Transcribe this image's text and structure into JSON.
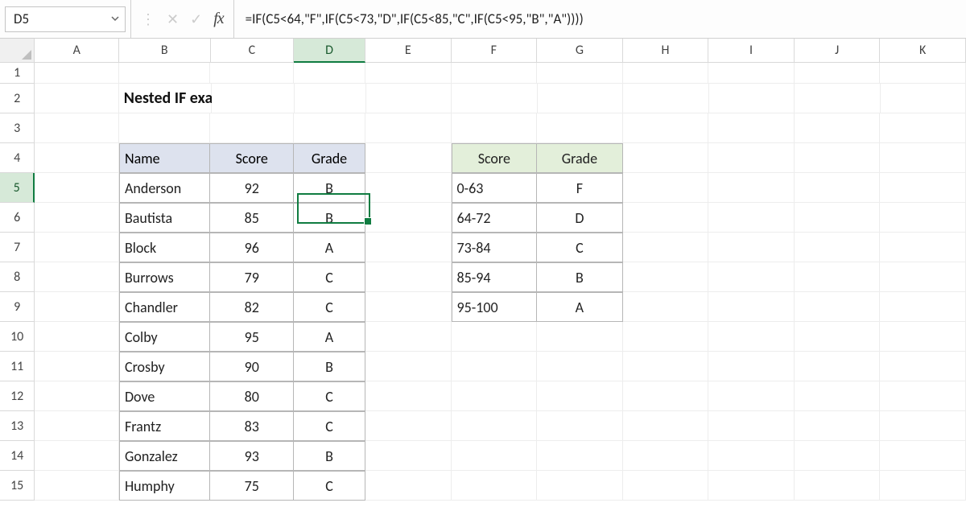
{
  "formula_bar": {
    "namebox_value": "D5",
    "formula": "=IF(C5<64,\"F\",IF(C5<73,\"D\",IF(C5<85,\"C\",IF(C5<95,\"B\",\"A\"))))"
  },
  "columns": [
    "A",
    "B",
    "C",
    "D",
    "E",
    "F",
    "G",
    "H",
    "I",
    "J",
    "K"
  ],
  "row_labels": [
    "1",
    "2",
    "3",
    "4",
    "5",
    "6",
    "7",
    "8",
    "9",
    "10",
    "11",
    "12",
    "13",
    "14",
    "15"
  ],
  "active": {
    "col": "D",
    "row": "5"
  },
  "title": "Nested IF example to assign grades",
  "table1": {
    "headers": {
      "name": "Name",
      "score": "Score",
      "grade": "Grade"
    },
    "rows": [
      {
        "name": "Anderson",
        "score": "92",
        "grade": "B"
      },
      {
        "name": "Bautista",
        "score": "85",
        "grade": "B"
      },
      {
        "name": "Block",
        "score": "96",
        "grade": "A"
      },
      {
        "name": "Burrows",
        "score": "79",
        "grade": "C"
      },
      {
        "name": "Chandler",
        "score": "82",
        "grade": "C"
      },
      {
        "name": "Colby",
        "score": "95",
        "grade": "A"
      },
      {
        "name": "Crosby",
        "score": "90",
        "grade": "B"
      },
      {
        "name": "Dove",
        "score": "80",
        "grade": "C"
      },
      {
        "name": "Frantz",
        "score": "83",
        "grade": "C"
      },
      {
        "name": "Gonzalez",
        "score": "93",
        "grade": "B"
      },
      {
        "name": "Humphy",
        "score": "75",
        "grade": "C"
      }
    ]
  },
  "table2": {
    "headers": {
      "score": "Score",
      "grade": "Grade"
    },
    "rows": [
      {
        "score": "0-63",
        "grade": "F"
      },
      {
        "score": "64-72",
        "grade": "D"
      },
      {
        "score": "73-84",
        "grade": "C"
      },
      {
        "score": "85-94",
        "grade": "B"
      },
      {
        "score": "95-100",
        "grade": "A"
      }
    ]
  }
}
